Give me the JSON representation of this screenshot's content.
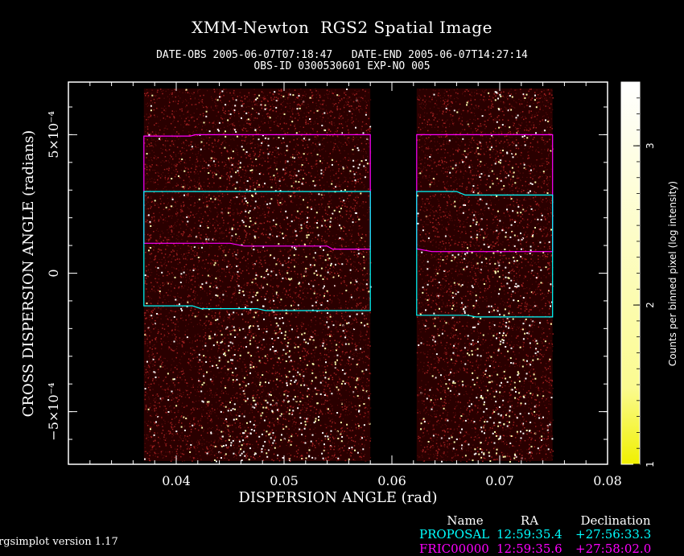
{
  "chart_data": {
    "type": "heatmap",
    "title": "XMM-Newton  RGS2 Spatial Image",
    "subtitle_lines": [
      "DATE-OBS 2005-06-07T07:18:47   DATE-END 2005-06-07T14:27:14",
      "OBS-ID 0300530601 EXP-NO 005"
    ],
    "xlabel": "DISPERSION ANGLE (rad)",
    "ylabel": "CROSS DISPERSION ANGLE (radians)",
    "xlim": [
      0.03,
      0.08
    ],
    "ylim": [
      -0.00069,
      0.00069
    ],
    "x_ticks": [
      {
        "value": 0.04,
        "label": "0.04"
      },
      {
        "value": 0.05,
        "label": "0.05"
      },
      {
        "value": 0.06,
        "label": "0.06"
      },
      {
        "value": 0.07,
        "label": "0.07"
      },
      {
        "value": 0.08,
        "label": "0.08"
      }
    ],
    "y_ticks": [
      {
        "value": 0.0005,
        "label": "5×10⁻⁴"
      },
      {
        "value": 0,
        "label": "0"
      },
      {
        "value": -0.0005,
        "label": "−5×10⁻⁴"
      }
    ],
    "colorbar": {
      "label": "Counts per binned pixel (log intensity)",
      "range": [
        1,
        3.4
      ],
      "ticks": [
        {
          "value": 1,
          "label": "1"
        },
        {
          "value": 2,
          "label": "2"
        },
        {
          "value": 3,
          "label": "3"
        }
      ],
      "color_low": "#f0f000",
      "color_high": "#ffffff"
    },
    "image_strips": [
      {
        "x0": 0.037,
        "x1": 0.058
      },
      {
        "x0": 0.0623,
        "x1": 0.0749
      }
    ],
    "regions": [
      {
        "color": "#ff00ff",
        "top": [
          [
            0.037,
            0.000495
          ],
          [
            0.0413,
            0.000495
          ],
          [
            0.0418,
            0.0005
          ],
          [
            0.058,
            0.0005
          ]
        ],
        "bottom": [
          [
            0.037,
            0.000108
          ],
          [
            0.045,
            0.000108
          ],
          [
            0.0463,
            9.8e-05
          ],
          [
            0.054,
            9.8e-05
          ],
          [
            0.0545,
            8.7e-05
          ],
          [
            0.058,
            8.7e-05
          ]
        ]
      },
      {
        "color": "#00ffff",
        "top": [
          [
            0.037,
            0.000295
          ],
          [
            0.058,
            0.000295
          ]
        ],
        "bottom": [
          [
            0.037,
            -0.000118
          ],
          [
            0.0415,
            -0.000118
          ],
          [
            0.0423,
            -0.000128
          ],
          [
            0.0475,
            -0.000128
          ],
          [
            0.0483,
            -0.000135
          ],
          [
            0.058,
            -0.000135
          ]
        ]
      },
      {
        "color": "#ff00ff",
        "top": [
          [
            0.0623,
            0.0005
          ],
          [
            0.0749,
            0.0005
          ]
        ],
        "bottom": [
          [
            0.0623,
            8.8e-05
          ],
          [
            0.0637,
            7.8e-05
          ],
          [
            0.0749,
            7.8e-05
          ]
        ]
      },
      {
        "color": "#00ffff",
        "top": [
          [
            0.0623,
            0.000295
          ],
          [
            0.066,
            0.000295
          ],
          [
            0.0668,
            0.000282
          ],
          [
            0.0749,
            0.000282
          ]
        ],
        "bottom": [
          [
            0.0623,
            -0.000152
          ],
          [
            0.067,
            -0.000152
          ],
          [
            0.0678,
            -0.000158
          ],
          [
            0.0749,
            -0.000158
          ]
        ]
      }
    ],
    "legend": {
      "headers": [
        "Name",
        "RA",
        "Declination"
      ],
      "rows": [
        {
          "name": "PROPOSAL",
          "ra": "12:59:35.4",
          "dec": "+27:56:33.3",
          "color": "#00ffff"
        },
        {
          "name": "FRIC00000",
          "ra": "12:59:35.6",
          "dec": "+27:58:02.0",
          "color": "#ff00ff"
        }
      ]
    }
  },
  "footer": {
    "version": "rgsimplot version 1.17"
  }
}
